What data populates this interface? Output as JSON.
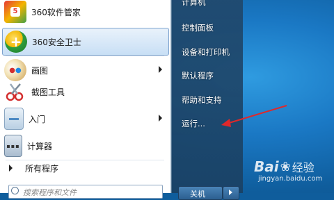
{
  "start_menu": {
    "left_items": [
      {
        "label": "360软件管家",
        "icon": "360-software-manager-icon",
        "has_submenu": false
      },
      {
        "label": "360安全卫士",
        "icon": "360-safe-guard-icon",
        "has_submenu": false,
        "highlighted": true
      },
      {
        "label": "画图",
        "icon": "paint-icon",
        "has_submenu": true
      },
      {
        "label": "截图工具",
        "icon": "snipping-tool-icon",
        "has_submenu": false
      },
      {
        "label": "入门",
        "icon": "getting-started-icon",
        "has_submenu": true
      },
      {
        "label": "计算器",
        "icon": "calculator-icon",
        "has_submenu": false
      }
    ],
    "all_programs": "所有程序",
    "search_placeholder": "搜索程序和文件",
    "right_links": [
      "计算机",
      "控制面板",
      "设备和打印机",
      "默认程序",
      "帮助和支持",
      "运行..."
    ],
    "shutdown_label": "关机"
  },
  "watermark": {
    "brand": "Bai",
    "suffix": "经验",
    "url": "jingyan.baidu.com"
  },
  "colors": {
    "highlight": "#c8dff5",
    "right_panel": "#1f4466",
    "annotation_arrow": "#e0282a"
  }
}
